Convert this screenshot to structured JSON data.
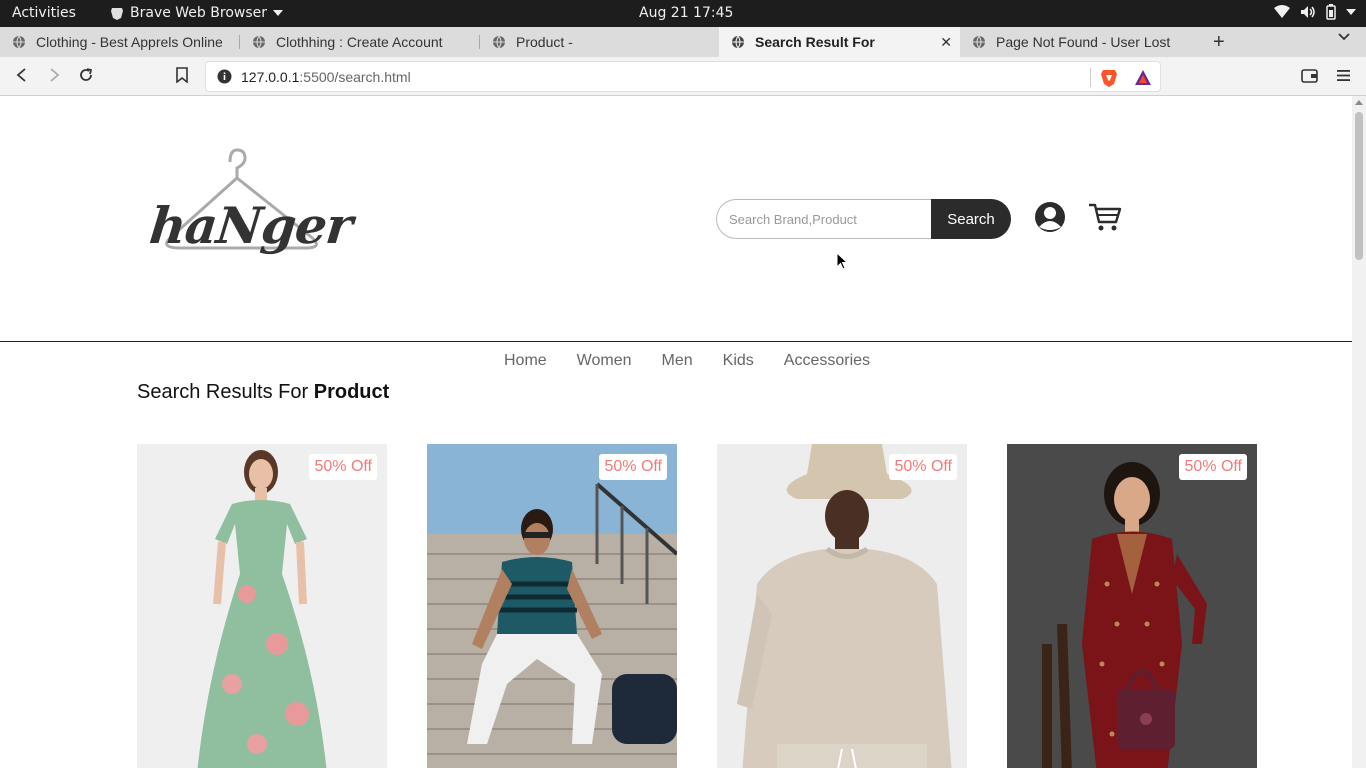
{
  "system": {
    "activities": "Activities",
    "app_name": "Brave Web Browser",
    "clock": "Aug 21  17:45"
  },
  "tabs": [
    {
      "title": "Clothing - Best Apprels Online"
    },
    {
      "title": "Clothhing : Create Account"
    },
    {
      "title": "Product -"
    },
    {
      "title": "Search Result For",
      "active": true
    },
    {
      "title": "Page Not Found - User Lost"
    }
  ],
  "address": {
    "host": "127.0.0.1",
    "path": ":5500/search.html"
  },
  "site": {
    "logo_text": "haNger",
    "search": {
      "placeholder": "Search Brand,Product",
      "button": "Search"
    },
    "nav": [
      "Home",
      "Women",
      "Men",
      "Kids",
      "Accessories"
    ],
    "results_prefix": "Search Results For",
    "results_query": "Product",
    "products": [
      {
        "badge": "50% Off",
        "image": "woman in green floral dress"
      },
      {
        "badge": "50% Off",
        "image": "man in striped t-shirt on stairs"
      },
      {
        "badge": "50% Off",
        "image": "man in beige sweatshirt and bucket hat"
      },
      {
        "badge": "50% Off",
        "image": "woman in maroon embroidered kurta"
      }
    ]
  },
  "colors": {
    "badge_text": "#f07b7b",
    "search_button": "#2b2b2b"
  }
}
